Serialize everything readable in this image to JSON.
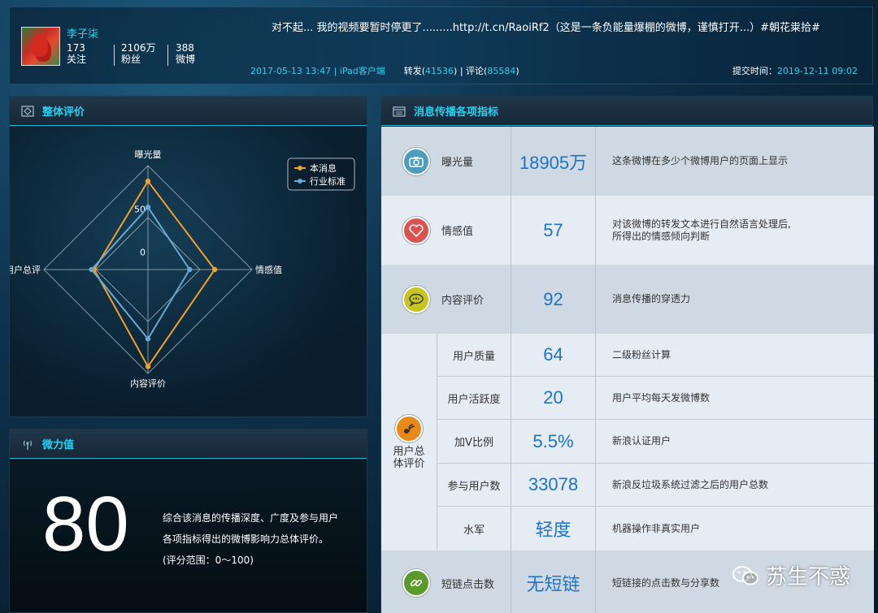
{
  "user": {
    "name": "李子柒",
    "following": "173",
    "following_label": "关注",
    "fans": "2106万",
    "fans_label": "粉丝",
    "posts": "388",
    "posts_label": "微博"
  },
  "post": {
    "text": "对不起... 我的视频要暂时停更了.........http://t.cn/RaoiRf2（这是一条负能量爆棚的微博，谨慎打开...）#朝花粜拾#",
    "date_source": "2017-05-13 13:47 | iPad客户端",
    "repost_label": "转发(",
    "repost_count": "41536",
    "repost_close": ")",
    "sep": " | ",
    "comment_label": "评论(",
    "comment_count": "85584",
    "comment_close": ")",
    "submit_label": "提交时间：",
    "submit_time": "2019-12-11 09:02"
  },
  "radar_panel": {
    "title": "整体评价",
    "tick_50": "50",
    "tick_0": "0"
  },
  "chart_data": {
    "type": "radar",
    "axes": [
      "曝光量",
      "情感值",
      "内容评价",
      "用户总评"
    ],
    "series": [
      {
        "name": "本消息",
        "color": "#f0a12a",
        "values": [
          82,
          57,
          92,
          42
        ]
      },
      {
        "name": "行业标准",
        "color": "#6aa8cf",
        "values": [
          52,
          28,
          60,
          45
        ]
      }
    ],
    "ticks": [
      "0",
      "50"
    ],
    "range": [
      -20,
      100
    ],
    "legend": "top-right"
  },
  "power_panel": {
    "title": "微力值",
    "score": "80",
    "desc_line1": "综合该消息的传播深度、广度及参与用户",
    "desc_line2": "各项指标得出的微博影响力总体评价。",
    "desc_line3": "(评分范围：0～100)"
  },
  "metrics_panel": {
    "title": "消息传播各项指标",
    "rows": [
      {
        "label": "曝光量",
        "value": "18905万",
        "desc": "这条微博在多少个微博用户的页面上显示",
        "icon": "camera-icon",
        "icon_color": "#4e9cc0"
      },
      {
        "label": "情感值",
        "value": "57",
        "desc": "对该微博的转发文本进行自然语言处理后,",
        "desc2": "所得出的情感倾向判断",
        "icon": "heart-icon",
        "icon_color": "#d9534f"
      },
      {
        "label": "内容评价",
        "value": "92",
        "desc": "消息传播的穿透力",
        "icon": "speech-bubble-icon",
        "icon_color": "#c9c51f"
      }
    ],
    "group_label_1": "用户总",
    "group_label_2": "体评价",
    "group_icon_color": "#e88a1a",
    "sub_rows": [
      {
        "label": "用户质量",
        "value": "64",
        "desc": "二级粉丝计算"
      },
      {
        "label": "用户活跃度",
        "value": "20",
        "desc": "用户平均每天发微博数"
      },
      {
        "label": "加V比例",
        "value": "5.5%",
        "desc": "新浪认证用户"
      },
      {
        "label": "参与用户数",
        "value": "33078",
        "desc": "新浪反垃圾系统过滤之后的用户总数"
      },
      {
        "label": "水军",
        "value": "轻度",
        "desc": "机器操作非真实用户"
      }
    ],
    "last_row": {
      "label": "短链点击数",
      "value": "无短链",
      "desc": "短链接的点击数与分享数",
      "icon": "link-icon",
      "icon_color": "#5a9a2a"
    }
  },
  "watermark": {
    "text": "苏生不惑"
  }
}
